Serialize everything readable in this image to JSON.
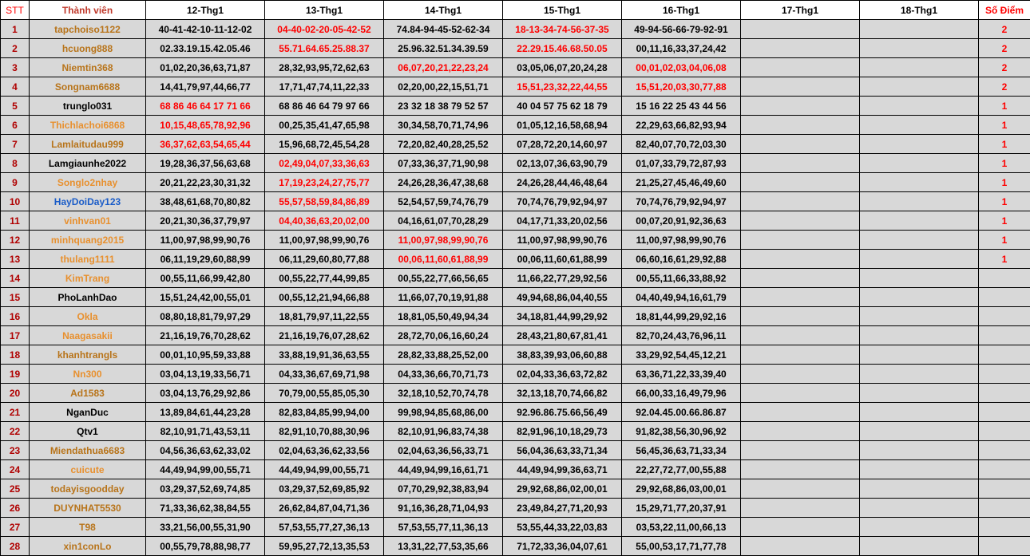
{
  "headers": [
    "STT",
    "Thành viên",
    "12-Thg1",
    "13-Thg1",
    "14-Thg1",
    "15-Thg1",
    "16-Thg1",
    "17-Thg1",
    "18-Thg1",
    "Số Điểm"
  ],
  "rows": [
    {
      "stt": "1",
      "name": "tapchoiso1122",
      "nc": "brown",
      "d": [
        "40-41-42-10-11-12-02",
        "04-40-02-20-05-42-52",
        "74.84-94-45-52-62-34",
        "18-13-34-74-56-37-35",
        "49-94-56-66-79-92-91"
      ],
      "r": [
        0,
        1,
        0,
        1,
        0
      ],
      "score": "2"
    },
    {
      "stt": "2",
      "name": "hcuong888",
      "nc": "brown",
      "d": [
        "02.33.19.15.42.05.46",
        "55.71.64.65.25.88.37",
        "25.96.32.51.34.39.59",
        "22.29.15.46.68.50.05",
        "00,11,16,33,37,24,42"
      ],
      "r": [
        0,
        1,
        0,
        1,
        0
      ],
      "score": "2"
    },
    {
      "stt": "3",
      "name": "Niemtin368",
      "nc": "brown",
      "d": [
        "01,02,20,36,63,71,87",
        "28,32,93,95,72,62,63",
        "06,07,20,21,22,23,24",
        "03,05,06,07,20,24,28",
        "00,01,02,03,04,06,08"
      ],
      "r": [
        0,
        0,
        1,
        0,
        1
      ],
      "score": "2"
    },
    {
      "stt": "4",
      "name": "Songnam6688",
      "nc": "brown",
      "d": [
        "14,41,79,97,44,66,77",
        "17,71,47,74,11,22,33",
        "02,20,00,22,15,51,71",
        "15,51,23,32,22,44,55",
        "15,51,20,03,30,77,88"
      ],
      "r": [
        0,
        0,
        0,
        1,
        1
      ],
      "score": "2"
    },
    {
      "stt": "5",
      "name": "trunglo031",
      "nc": "black",
      "d": [
        "68 86 46 64 17 71 66",
        "68 86 46 64 79 97 66",
        "23 32 18 38 79 52 57",
        "40 04 57 75 62 18 79",
        "15 16 22 25 43 44 56"
      ],
      "r": [
        1,
        0,
        0,
        0,
        0
      ],
      "score": "1"
    },
    {
      "stt": "6",
      "name": "Thichlachoi6868",
      "nc": "orange",
      "d": [
        "10,15,48,65,78,92,96",
        "00,25,35,41,47,65,98",
        "30,34,58,70,71,74,96",
        "01,05,12,16,58,68,94",
        "22,29,63,66,82,93,94"
      ],
      "r": [
        1,
        0,
        0,
        0,
        0
      ],
      "score": "1"
    },
    {
      "stt": "7",
      "name": "Lamlaitudau999",
      "nc": "brown",
      "d": [
        "36,37,62,63,54,65,44",
        "15,96,68,72,45,54,28",
        "72,20,82,40,28,25,52",
        "07,28,72,20,14,60,97",
        "82,40,07,70,72,03,30"
      ],
      "r": [
        1,
        0,
        0,
        0,
        0
      ],
      "score": "1"
    },
    {
      "stt": "8",
      "name": "Lamgiaunhe2022",
      "nc": "black",
      "d": [
        "19,28,36,37,56,63,68",
        "02,49,04,07,33,36,63",
        "07,33,36,37,71,90,98",
        "02,13,07,36,63,90,79",
        "01,07,33,79,72,87,93"
      ],
      "r": [
        0,
        1,
        0,
        0,
        0
      ],
      "score": "1"
    },
    {
      "stt": "9",
      "name": "Songlo2nhay",
      "nc": "orange",
      "d": [
        "20,21,22,23,30,31,32",
        "17,19,23,24,27,75,77",
        "24,26,28,36,47,38,68",
        "24,26,28,44,46,48,64",
        "21,25,27,45,46,49,60"
      ],
      "r": [
        0,
        1,
        0,
        0,
        0
      ],
      "score": "1"
    },
    {
      "stt": "10",
      "name": "HayDoiDay123",
      "nc": "blue",
      "d": [
        "38,48,61,68,70,80,82",
        "55,57,58,59,84,86,89",
        "52,54,57,59,74,76,79",
        "70,74,76,79,92,94,97",
        "70,74,76,79,92,94,97"
      ],
      "r": [
        0,
        1,
        0,
        0,
        0
      ],
      "score": "1"
    },
    {
      "stt": "11",
      "name": "vinhvan01",
      "nc": "orange",
      "d": [
        "20,21,30,36,37,79,97",
        "04,40,36,63,20,02,00",
        "04,16,61,07,70,28,29",
        "04,17,71,33,20,02,56",
        "00,07,20,91,92,36,63"
      ],
      "r": [
        0,
        1,
        0,
        0,
        0
      ],
      "score": "1"
    },
    {
      "stt": "12",
      "name": "minhquang2015",
      "nc": "orange",
      "d": [
        "11,00,97,98,99,90,76",
        "11,00,97,98,99,90,76",
        "11,00,97,98,99,90,76",
        "11,00,97,98,99,90,76",
        "11,00,97,98,99,90,76"
      ],
      "r": [
        0,
        0,
        1,
        0,
        0
      ],
      "score": "1"
    },
    {
      "stt": "13",
      "name": "thulang1111",
      "nc": "orange",
      "d": [
        "06,11,19,29,60,88,99",
        "06,11,29,60,80,77,88",
        "00,06,11,60,61,88,99",
        "00,06,11,60,61,88,99",
        "06,60,16,61,29,92,88"
      ],
      "r": [
        0,
        0,
        1,
        0,
        0
      ],
      "score": "1"
    },
    {
      "stt": "14",
      "name": "KimTrang",
      "nc": "orange",
      "d": [
        "00,55,11,66,99,42,80",
        "00,55,22,77,44,99,85",
        "00,55,22,77,66,56,65",
        "11,66,22,77,29,92,56",
        "00,55,11,66,33,88,92"
      ],
      "r": [
        0,
        0,
        0,
        0,
        0
      ],
      "score": ""
    },
    {
      "stt": "15",
      "name": "PhoLanhDao",
      "nc": "black",
      "d": [
        "15,51,24,42,00,55,01",
        "00,55,12,21,94,66,88",
        "11,66,07,70,19,91,88",
        "49,94,68,86,04,40,55",
        "04,40,49,94,16,61,79"
      ],
      "r": [
        0,
        0,
        0,
        0,
        0
      ],
      "score": ""
    },
    {
      "stt": "16",
      "name": "Okla",
      "nc": "orange",
      "d": [
        "08,80,18,81,79,97,29",
        "18,81,79,97,11,22,55",
        "18,81,05,50,49,94,34",
        "34,18,81,44,99,29,92",
        "18,81,44,99,29,92,16"
      ],
      "r": [
        0,
        0,
        0,
        0,
        0
      ],
      "score": ""
    },
    {
      "stt": "17",
      "name": "Naagasakii",
      "nc": "orange",
      "d": [
        "21,16,19,76,70,28,62",
        "21,16,19,76,07,28,62",
        "28,72,70,06,16,60,24",
        "28,43,21,80,67,81,41",
        "82,70,24,43,76,96,11"
      ],
      "r": [
        0,
        0,
        0,
        0,
        0
      ],
      "score": ""
    },
    {
      "stt": "18",
      "name": "khanhtrangls",
      "nc": "brown",
      "d": [
        "00,01,10,95,59,33,88",
        "33,88,19,91,36,63,55",
        "28,82,33,88,25,52,00",
        "38,83,39,93,06,60,88",
        "33,29,92,54,45,12,21"
      ],
      "r": [
        0,
        0,
        0,
        0,
        0
      ],
      "score": ""
    },
    {
      "stt": "19",
      "name": "Nn300",
      "nc": "orange",
      "d": [
        "03,04,13,19,33,56,71",
        "04,33,36,67,69,71,98",
        "04,33,36,66,70,71,73",
        "02,04,33,36,63,72,82",
        "63,36,71,22,33,39,40"
      ],
      "r": [
        0,
        0,
        0,
        0,
        0
      ],
      "score": ""
    },
    {
      "stt": "20",
      "name": "Ad1583",
      "nc": "brown",
      "d": [
        "03,04,13,76,29,92,86",
        "70,79,00,55,85,05,30",
        "32,18,10,52,70,74,78",
        "32,13,18,70,74,66,82",
        "66,00,33,16,49,79,96"
      ],
      "r": [
        0,
        0,
        0,
        0,
        0
      ],
      "score": ""
    },
    {
      "stt": "21",
      "name": "NganDuc",
      "nc": "black",
      "d": [
        "13,89,84,61,44,23,28",
        "82,83,84,85,99,94,00",
        "99,98,94,85,68,86,00",
        "92.96.86.75.66,56,49",
        "92.04.45.00.66.86.87"
      ],
      "r": [
        0,
        0,
        0,
        0,
        0
      ],
      "score": ""
    },
    {
      "stt": "22",
      "name": "Qtv1",
      "nc": "black",
      "d": [
        "82,10,91,71,43,53,11",
        "82,91,10,70,88,30,96",
        "82,10,91,96,83,74,38",
        "82,91,96,10,18,29,73",
        "91,82,38,56,30,96,92"
      ],
      "r": [
        0,
        0,
        0,
        0,
        0
      ],
      "score": ""
    },
    {
      "stt": "23",
      "name": "Miendathua6683",
      "nc": "brown",
      "d": [
        "04,56,36,63,62,33,02",
        "02,04,63,36,62,33,56",
        "02,04,63,36,56,33,71",
        "56,04,36,63,33,71,34",
        "56,45,36,63,71,33,34"
      ],
      "r": [
        0,
        0,
        0,
        0,
        0
      ],
      "score": ""
    },
    {
      "stt": "24",
      "name": "cuicute",
      "nc": "orange",
      "d": [
        "44,49,94,99,00,55,71",
        "44,49,94,99,00,55,71",
        "44,49,94,99,16,61,71",
        "44,49,94,99,36,63,71",
        "22,27,72,77,00,55,88"
      ],
      "r": [
        0,
        0,
        0,
        0,
        0
      ],
      "score": ""
    },
    {
      "stt": "25",
      "name": "todayisgoodday",
      "nc": "brown",
      "d": [
        "03,29,37,52,69,74,85",
        "03,29,37,52,69,85,92",
        "07,70,29,92,38,83,94",
        "29,92,68,86,02,00,01",
        "29,92,68,86,03,00,01"
      ],
      "r": [
        0,
        0,
        0,
        0,
        0
      ],
      "score": ""
    },
    {
      "stt": "26",
      "name": "DUYNHAT5530",
      "nc": "brown",
      "d": [
        "71,33,36,62,38,84,55",
        "26,62,84,87,04,71,36",
        "91,16,36,28,71,04,93",
        "23,49,84,27,71,20,93",
        "15,29,71,77,20,37,91"
      ],
      "r": [
        0,
        0,
        0,
        0,
        0
      ],
      "score": ""
    },
    {
      "stt": "27",
      "name": "T98",
      "nc": "brown",
      "d": [
        "33,21,56,00,55,31,90",
        "57,53,55,77,27,36,13",
        "57,53,55,77,11,36,13",
        "53,55,44,33,22,03,83",
        "03,53,22,11,00,66,13"
      ],
      "r": [
        0,
        0,
        0,
        0,
        0
      ],
      "score": ""
    },
    {
      "stt": "28",
      "name": "xin1conLo",
      "nc": "brown",
      "d": [
        "00,55,79,78,88,98,77",
        "59,95,27,72,13,35,53",
        "13,31,22,77,53,35,66",
        "71,72,33,36,04,07,61",
        "55,00,53,17,71,77,78"
      ],
      "r": [
        0,
        0,
        0,
        0,
        0
      ],
      "score": ""
    }
  ]
}
